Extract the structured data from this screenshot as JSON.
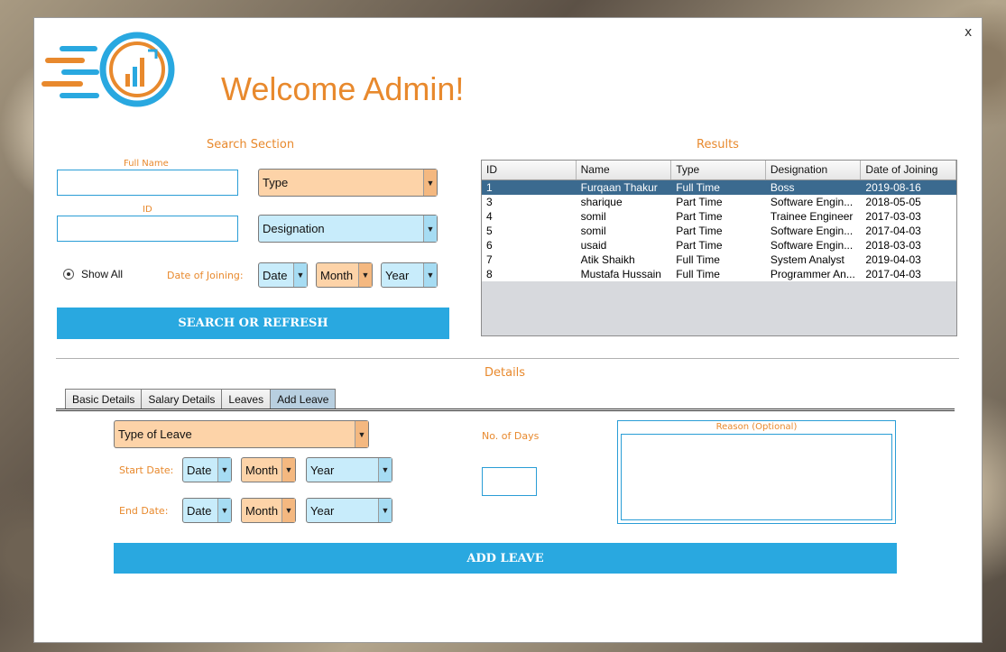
{
  "window": {
    "close_label": "x"
  },
  "header": {
    "welcome_text": "Welcome Admin!"
  },
  "search": {
    "title": "Search Section",
    "full_name_label": "Full Name",
    "full_name_value": "",
    "id_label": "ID",
    "id_value": "",
    "type_combo": "Type",
    "designation_combo": "Designation",
    "show_all_label": "Show All",
    "date_of_joining_label": "Date of Joining:",
    "date_combo": "Date",
    "month_combo": "Month",
    "year_combo": "Year",
    "search_button": "SEARCH OR REFRESH"
  },
  "results": {
    "title": "Results",
    "columns": [
      "ID",
      "Name",
      "Type",
      "Designation",
      "Date of Joining"
    ],
    "rows": [
      [
        "1",
        "Furqaan Thakur",
        "Full Time",
        "Boss",
        "2019-08-16"
      ],
      [
        "3",
        "sharique",
        "Part Time",
        "Software Engin...",
        "2018-05-05"
      ],
      [
        "4",
        "somil",
        "Part Time",
        "Trainee Engineer",
        "2017-03-03"
      ],
      [
        "5",
        "somil",
        "Part Time",
        "Software Engin...",
        "2017-04-03"
      ],
      [
        "6",
        "usaid",
        "Part Time",
        "Software Engin...",
        "2018-03-03"
      ],
      [
        "7",
        "Atik Shaikh",
        "Full Time",
        "System Analyst",
        "2019-04-03"
      ],
      [
        "8",
        "Mustafa Hussain",
        "Full Time",
        "Programmer An...",
        "2017-04-03"
      ]
    ],
    "selected_row": 0
  },
  "details": {
    "title": "Details",
    "tabs": [
      "Basic Details",
      "Salary Details",
      "Leaves",
      "Add Leave"
    ],
    "active_tab": "Add Leave",
    "type_of_leave_combo": "Type of Leave",
    "start_date_label": "Start Date:",
    "end_date_label": "End Date:",
    "date_combo": "Date",
    "month_combo": "Month",
    "year_combo": "Year",
    "no_of_days_label": "No. of Days",
    "no_of_days_value": "",
    "reason_label": "Reason (Optional)",
    "add_leave_button": "ADD LEAVE"
  },
  "colors": {
    "accent_orange": "#e8892d",
    "accent_blue": "#29a8e0",
    "selected_row": "#3b6a8f"
  }
}
